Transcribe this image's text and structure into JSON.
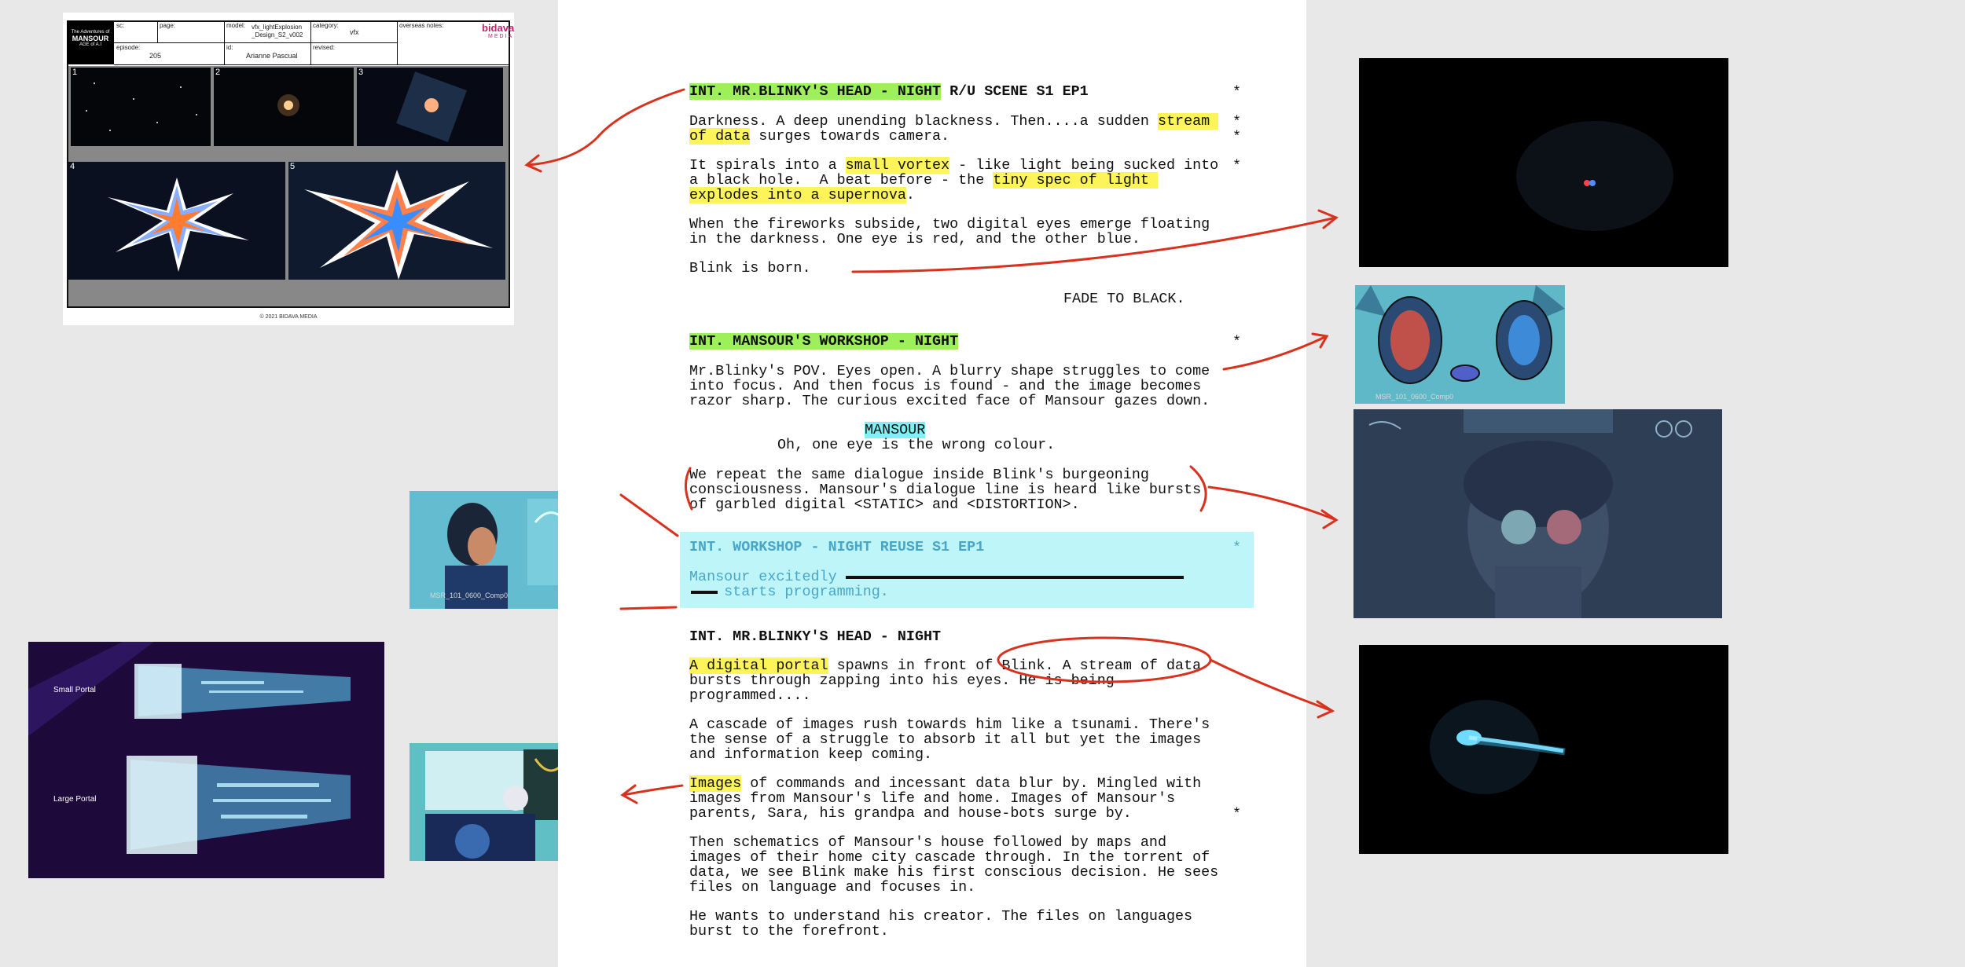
{
  "storyboard_sheet": {
    "logo_top": "The Adventures of",
    "logo_main": "MANSOUR",
    "logo_sub": "AGE of A.I",
    "labels": {
      "sc": "sc:",
      "page": "page:",
      "model": "model:",
      "category": "category:",
      "overseas": "overseas notes:",
      "episode": "episode:",
      "id": "id:",
      "revised": "revised:"
    },
    "model_value": "vfx_lightExplosion _Design_S2_v002",
    "category_value": "vfx",
    "episode_value": "205",
    "id_value": "Arianne Pascual",
    "brand_top": "bidava",
    "brand_bottom": "MEDIA",
    "panel_numbers": [
      "1",
      "2",
      "3",
      "4",
      "5"
    ],
    "footer": "© 2021 BIDAVA MEDIA"
  },
  "script": {
    "scene1_heading": "INT. MR.BLINKY'S HEAD - NIGHT",
    "scene1_suffix": " R/U SCENE S1 EP1",
    "p1_l1a": "Darkness. A deep unending blackness. Then....a sudden ",
    "p1_l1b": "stream ",
    "p1_l2a": "of data",
    "p1_l2b": " surges towards camera.",
    "p2_l1a": "It spirals into a ",
    "p2_l1b": "small vortex",
    "p2_l1c": " - like light being sucked into",
    "p2_l2a": "a black hole.  A beat before - the ",
    "p2_l2b": "tiny spec of light ",
    "p2_l3a": "explodes into a supernova",
    "p2_l3b": ".",
    "p3_l1": "When the fireworks subside, two digital eyes emerge floating",
    "p3_l2": "in the darkness. One eye is red, and the other blue.",
    "p4": "Blink is born.",
    "transition": "FADE TO BLACK.",
    "scene2_heading": "INT. MANSOUR'S WORKSHOP - NIGHT",
    "p5_l1": "Mr.Blinky's POV. Eyes open. A blurry shape struggles to come",
    "p5_l2": "into focus. And then focus is found - and the image becomes",
    "p5_l3": "razor sharp. The curious excited face of Mansour gazes down.",
    "character": "MANSOUR",
    "dialogue": "Oh, one eye is the wrong colour.",
    "p6_l1": "We repeat the same dialogue inside Blink's burgeoning",
    "p6_l2": "consciousness. Mansour's dialogue line is heard like bursts",
    "p6_l3": "of garbled digital <STATIC> and <DISTORTION>.",
    "reuse_heading": "INT. WORKSHOP - NIGHT REUSE S1 EP1",
    "reuse_l1": "Mansour excitedly",
    "reuse_l2": "    starts programming.",
    "scene3_heading": "INT. MR.BLINKY'S HEAD - NIGHT",
    "p7_l1a": "A digital portal",
    "p7_l1b": " spawns in front of Blink. A stream of data",
    "p7_l2": "bursts through zapping into his eyes. He is being",
    "p7_l3": "programmed....",
    "p8_l1": "A cascade of images rush towards him like a tsunami. There's",
    "p8_l2": "the sense of a struggle to absorb it all but yet the images",
    "p8_l3": "and information keep coming.",
    "p9_l1a": "Images",
    "p9_l1b": " of commands and incessant data blur by. Mingled with",
    "p9_l2": "images from Mansour's life and home. Images of Mansour's",
    "p9_l3": "parents, Sara, his grandpa and house-bots surge by.",
    "p10_l1": "Then schematics of Mansour's house followed by maps and",
    "p10_l2": "images of their home city cascade through. In the torrent of",
    "p10_l3": "data, we see Blink make his first conscious decision. He sees",
    "p10_l4": "files on language and focuses in.",
    "p11_l1": "He wants to understand his creator. The files on languages",
    "p11_l2": "burst to the forefront.",
    "revision_mark": "*"
  },
  "thumbnails": {
    "blinky_closeup_label": "MSR_101_0600_Comp0",
    "mansour_screen_label": "MSR_101_0600_Comp0"
  },
  "portal_image": {
    "small_label": "Small Portal",
    "large_label": "Large Portal"
  },
  "colors": {
    "slug_highlight": "#9ef05a",
    "text_highlight": "#fdf45a",
    "character_highlight": "#7ff0f4",
    "reuse_block": "#bdf5f8",
    "annotation_red": "#d8321e"
  }
}
